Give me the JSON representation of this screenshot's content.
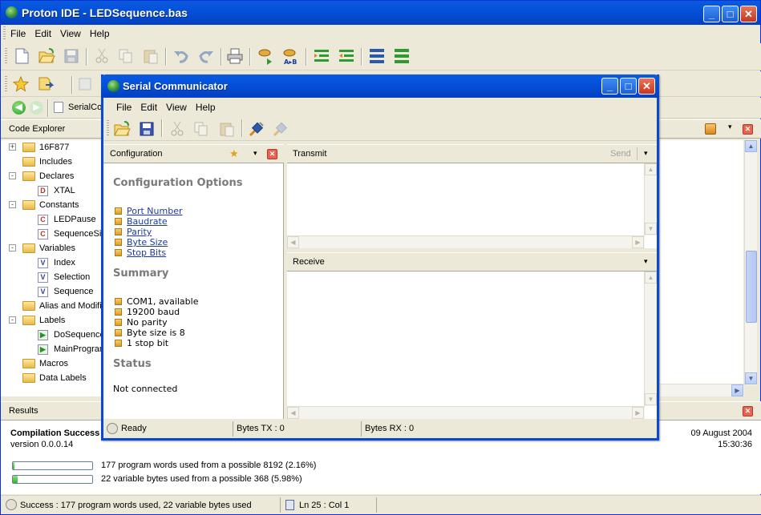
{
  "main": {
    "title": "Proton IDE - LEDSequence.bas",
    "menu": [
      "File",
      "Edit",
      "View",
      "Help"
    ],
    "tab_label": "SerialCon",
    "code_explorer_title": "Code Explorer",
    "results_title": "Results"
  },
  "tree": [
    {
      "label": "16F877",
      "kind": "folder",
      "level": 0,
      "expander": "+"
    },
    {
      "label": "Includes",
      "kind": "folder",
      "level": 0,
      "expander": ""
    },
    {
      "label": "Declares",
      "kind": "folder",
      "level": 0,
      "expander": "-"
    },
    {
      "label": "XTAL",
      "kind": "D",
      "level": 1
    },
    {
      "label": "Constants",
      "kind": "folder",
      "level": 0,
      "expander": "-"
    },
    {
      "label": "LEDPause",
      "kind": "C",
      "level": 1
    },
    {
      "label": "SequenceSize",
      "kind": "C",
      "level": 1
    },
    {
      "label": "Variables",
      "kind": "folder",
      "level": 0,
      "expander": "-"
    },
    {
      "label": "Index",
      "kind": "V",
      "level": 1
    },
    {
      "label": "Selection",
      "kind": "V",
      "level": 1
    },
    {
      "label": "Sequence",
      "kind": "V",
      "level": 1
    },
    {
      "label": "Alias and Modifiers",
      "kind": "folder",
      "level": 0,
      "expander": ""
    },
    {
      "label": "Labels",
      "kind": "folder",
      "level": 0,
      "expander": "-"
    },
    {
      "label": "DoSequence",
      "kind": "L",
      "level": 1
    },
    {
      "label": "MainProgram",
      "kind": "L",
      "level": 1
    },
    {
      "label": "Macros",
      "kind": "folder",
      "level": 0,
      "expander": ""
    },
    {
      "label": "Data Labels",
      "kind": "folder",
      "level": 0,
      "expander": ""
    }
  ],
  "results": {
    "heading": "Compilation Success",
    "version": "version 0.0.0.14",
    "date": "09 August 2004",
    "time": "15:30:36",
    "program_words_text": "177 program words used from a possible 8192 (2.16%)",
    "program_words_fraction": 0.0216,
    "variable_bytes_text": "22 variable bytes used from a possible 368 (5.98%)",
    "variable_bytes_fraction": 0.0598
  },
  "statusbar": {
    "message": "Success : 177 program words used, 22 variable bytes used",
    "position": "Ln 25 : Col 1"
  },
  "serial": {
    "title": "Serial Communicator",
    "menu": [
      "File",
      "Edit",
      "View",
      "Help"
    ],
    "config_panel_title": "Configuration",
    "config_options_heading": "Configuration Options",
    "options": [
      "Port Number",
      "Baudrate",
      "Parity",
      "Byte Size",
      "Stop Bits"
    ],
    "summary_heading": "Summary",
    "summary": [
      "COM1, available",
      "19200 baud",
      "No parity",
      "Byte size is 8",
      "1 stop bit"
    ],
    "status_heading": "Status",
    "status_text": "Not connected",
    "transmit_title": "Transmit",
    "send_label": "Send",
    "receive_title": "Receive",
    "status_ready": "Ready",
    "bytes_tx": "Bytes TX : 0",
    "bytes_rx": "Bytes RX : 0"
  }
}
